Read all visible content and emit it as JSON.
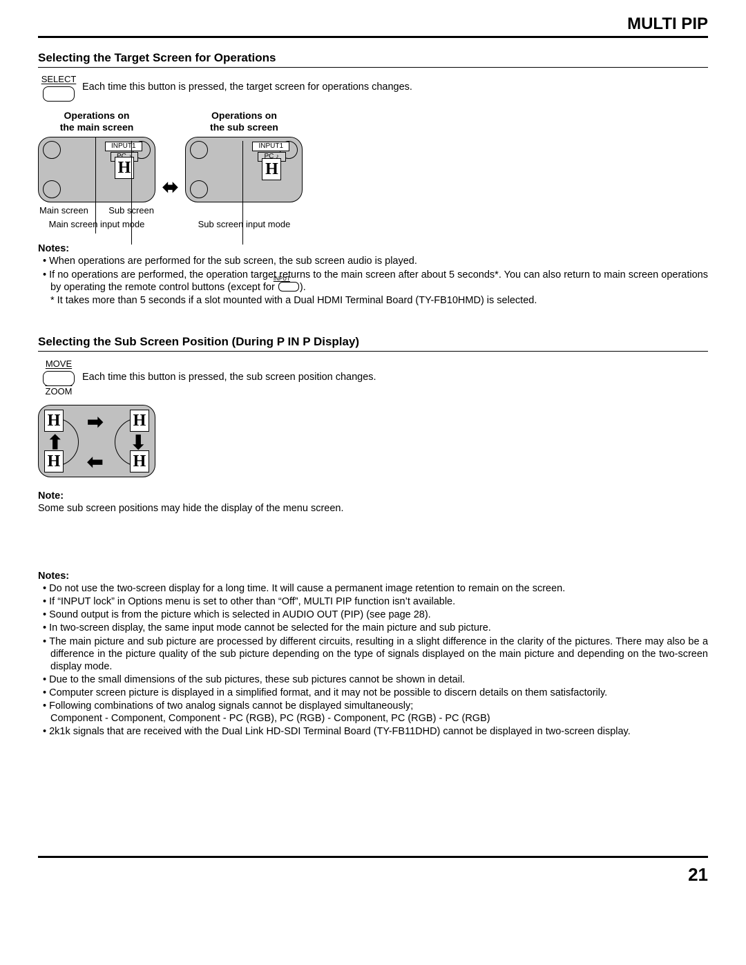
{
  "header": {
    "title": "MULTI PIP"
  },
  "section1": {
    "heading": "Selecting the Target Screen for Operations",
    "button": {
      "top": "SELECT",
      "bottom": ""
    },
    "desc": "Each time this button is pressed, the target screen for operations changes.",
    "diag": {
      "left_label_l1": "Operations on",
      "left_label_l2": "the main screen",
      "right_label_l1": "Operations on",
      "right_label_l2": "the sub screen",
      "input_label": "INPUT1",
      "pc_label": "PC",
      "h": "H",
      "caption_main": "Main screen",
      "caption_sub": "Sub screen",
      "caption_main_mode": "Main screen input mode",
      "caption_sub_mode": "Sub screen input mode"
    },
    "notes_label": "Notes:",
    "notes": [
      "When operations are performed for the sub screen, the sub screen audio is played.",
      "If no operations are performed, the operation target returns to the main screen after about 5 seconds*. You can also return to main screen operations by operating the remote control buttons (except for "
    ],
    "note2_suffix": ").",
    "input_btn_label": "INPUT",
    "note_asterisk": "* It takes more than 5 seconds if a slot mounted with a Dual HDMI Terminal Board (TY-FB10HMD) is selected."
  },
  "section2": {
    "heading": "Selecting the Sub Screen Position (During P IN P Display)",
    "button": {
      "top": "MOVE",
      "bottom": "ZOOM"
    },
    "desc": "Each time this button is pressed, the sub screen position changes.",
    "h": "H",
    "note_label": "Note:",
    "note": "Some sub screen positions may hide the display of the menu screen."
  },
  "section3": {
    "notes_label": "Notes:",
    "notes": [
      "Do not use the two-screen display for a long time. It will cause a permanent image retention to remain on the screen.",
      "If “INPUT lock” in Options menu is set to other than “Off”, MULTI PIP function isn’t available.",
      "Sound output is from the picture which is selected in AUDIO OUT (PIP) (see page 28).",
      "In two-screen display, the same input mode cannot be selected for the main picture and sub picture.",
      "The main picture and sub picture are processed by different circuits, resulting in a slight difference in the clarity of the pictures. There may also be a difference in the picture quality of the sub picture depending on the type of signals displayed on the main picture and depending on the two-screen display mode.",
      "Due to the small dimensions of the sub pictures, these sub pictures cannot be shown in detail.",
      "Computer screen picture is displayed in a simplified format, and it may not be possible to discern details on them satisfactorily.",
      "Following combinations of two analog signals cannot be displayed simultaneously;\nComponent - Component, Component - PC (RGB), PC (RGB) - Component, PC (RGB) - PC (RGB)",
      "2k1k signals that are received with the Dual Link HD-SDI Terminal Board (TY-FB11DHD) cannot be displayed in two-screen display."
    ]
  },
  "footer": {
    "page": "21"
  }
}
